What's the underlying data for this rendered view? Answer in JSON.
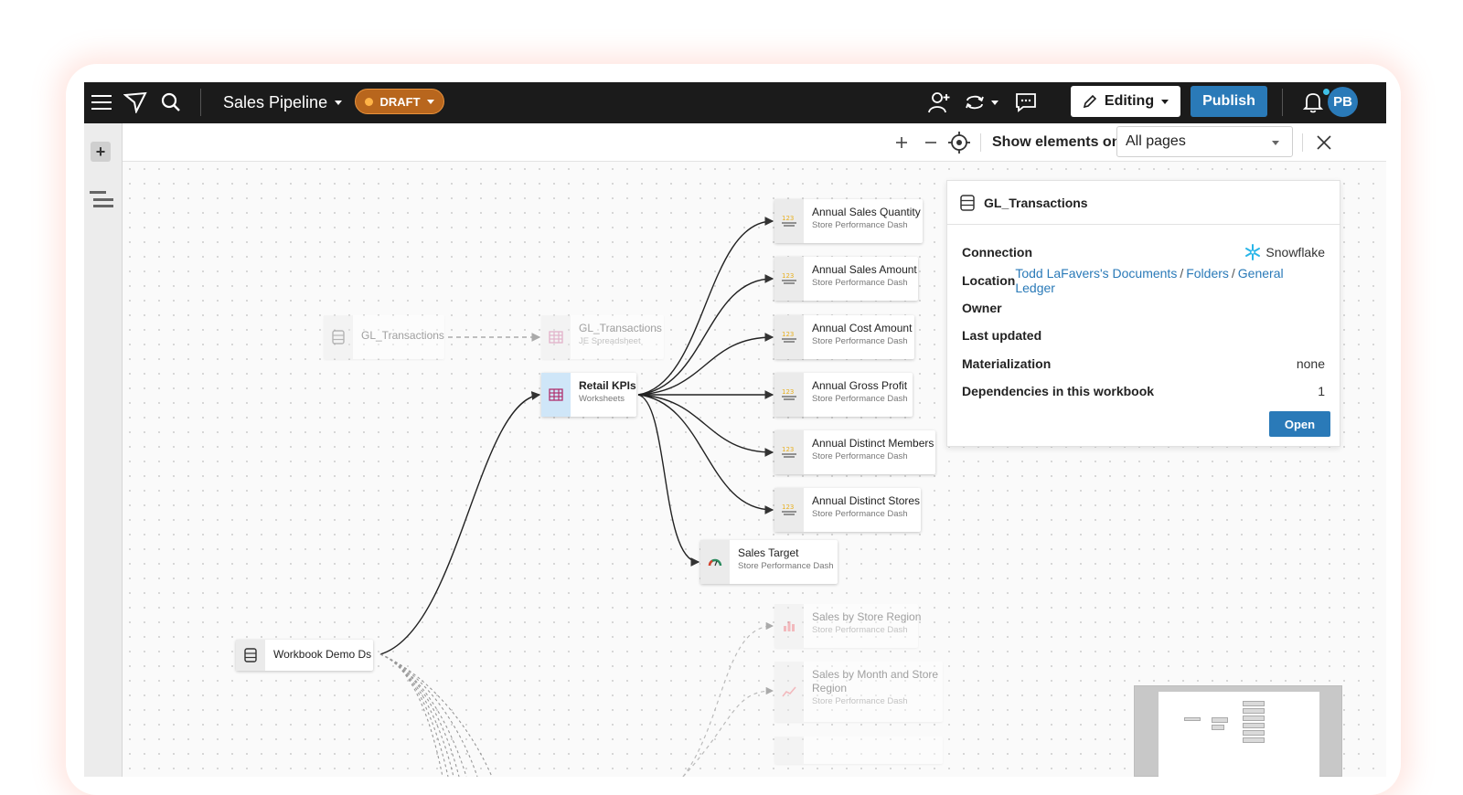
{
  "topbar": {
    "workbook_title": "Sales Pipeline",
    "status_badge": "DRAFT",
    "editing_label": "Editing",
    "publish_label": "Publish",
    "avatar_initials": "PB",
    "icons": [
      "menu-icon",
      "app-logo-icon",
      "search-icon",
      "share-user-icon",
      "sync-icon",
      "comment-icon",
      "pencil-icon",
      "bell-icon"
    ]
  },
  "lineage_toolbar": {
    "show_elements_label": "Show elements on",
    "pages_selected": "All pages"
  },
  "nodes": {
    "gl_source": {
      "title": "GL_Transactions",
      "subtitle": ""
    },
    "gl_spreadsheet": {
      "title": "GL_Transactions",
      "subtitle": "JE Spreadsheet"
    },
    "retail_kpis": {
      "title": "Retail KPIs",
      "subtitle": "Worksheets"
    },
    "workbook_demo": {
      "title": "Workbook Demo Ds",
      "subtitle": ""
    },
    "annual_sales_quantity": {
      "title": "Annual Sales Quantity",
      "subtitle": "Store Performance Dash"
    },
    "annual_sales_amount": {
      "title": "Annual Sales Amount",
      "subtitle": "Store Performance Dash"
    },
    "annual_cost_amount": {
      "title": "Annual Cost Amount",
      "subtitle": "Store Performance Dash"
    },
    "annual_gross_profit": {
      "title": "Annual Gross Profit",
      "subtitle": "Store Performance Dash"
    },
    "annual_distinct_members": {
      "title": "Annual Distinct Members",
      "subtitle": "Store Performance Dash"
    },
    "annual_distinct_stores": {
      "title": "Annual Distinct Stores",
      "subtitle": "Store Performance Dash"
    },
    "sales_target": {
      "title": "Sales Target",
      "subtitle": "Store Performance Dash"
    },
    "sales_by_store_region": {
      "title": "Sales by Store Region",
      "subtitle": "Store Performance Dash"
    },
    "sales_by_month_region": {
      "title": "Sales by Month and Store",
      "title2": "Region",
      "subtitle": "Store Performance Dash"
    }
  },
  "details_panel": {
    "title": "GL_Transactions",
    "connection_label": "Connection",
    "connection_value": "Snowflake",
    "location_label": "Location",
    "location_path": [
      "Todd LaFavers's Documents",
      "Folders",
      "General Ledger"
    ],
    "location_sep": "/",
    "owner_label": "Owner",
    "last_updated_label": "Last updated",
    "materialization_label": "Materialization",
    "materialization_value": "none",
    "dependencies_label": "Dependencies in this workbook",
    "dependencies_value": "1",
    "open_label": "Open"
  },
  "colors": {
    "topbar_bg": "#1b1b1b",
    "accent_blue": "#2a7ab8",
    "draft_orange": "#b8661d",
    "kpi_icon_yellow": "#e8b020"
  }
}
